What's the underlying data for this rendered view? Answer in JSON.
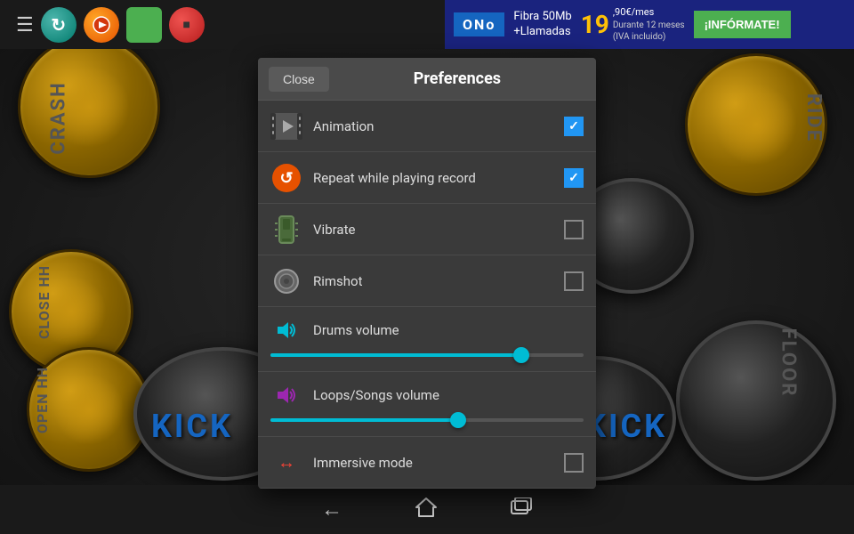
{
  "topBar": {
    "menuLabel": "☰",
    "buttons": [
      {
        "id": "refresh",
        "label": "↻"
      },
      {
        "id": "record",
        "label": "●"
      },
      {
        "id": "green",
        "label": ""
      },
      {
        "id": "stop",
        "label": "●"
      }
    ]
  },
  "ad": {
    "brand": "ONo",
    "line1": "Fibra 50Mb",
    "line2": "+Llamadas",
    "price": "19",
    "decimal": ",90€/mes",
    "note": "Durante 12 meses\n(IVA incluido)",
    "cta": "¡INFÓRMATE!"
  },
  "drumLabels": {
    "crash": "CRASH",
    "closeHH": "CLOSE HH",
    "openHH": "OPEN HH",
    "ride": "RIDE",
    "floor": "FLOOR",
    "kick1": "KICK",
    "kick2": "KICK"
  },
  "preferences": {
    "title": "Preferences",
    "closeBtn": "Close",
    "items": [
      {
        "id": "animation",
        "label": "Animation",
        "checked": true,
        "iconType": "animation"
      },
      {
        "id": "repeat",
        "label": "Repeat while playing record",
        "checked": true,
        "iconType": "repeat"
      },
      {
        "id": "vibrate",
        "label": "Vibrate",
        "checked": false,
        "iconType": "vibrate"
      },
      {
        "id": "rimshot",
        "label": "Rimshot",
        "checked": false,
        "iconType": "rimshot"
      }
    ],
    "sliders": [
      {
        "id": "drums-volume",
        "label": "Drums volume",
        "iconType": "vol-drums",
        "value": 80,
        "color": "#00bcd4"
      },
      {
        "id": "loops-volume",
        "label": "Loops/Songs volume",
        "iconType": "vol-loops",
        "value": 60,
        "color": "#00bcd4"
      }
    ],
    "immersive": {
      "label": "Immersive mode",
      "checked": false,
      "iconType": "immersive"
    }
  },
  "bottomNav": {
    "back": "←",
    "home": "⌂",
    "recent": "▭"
  }
}
